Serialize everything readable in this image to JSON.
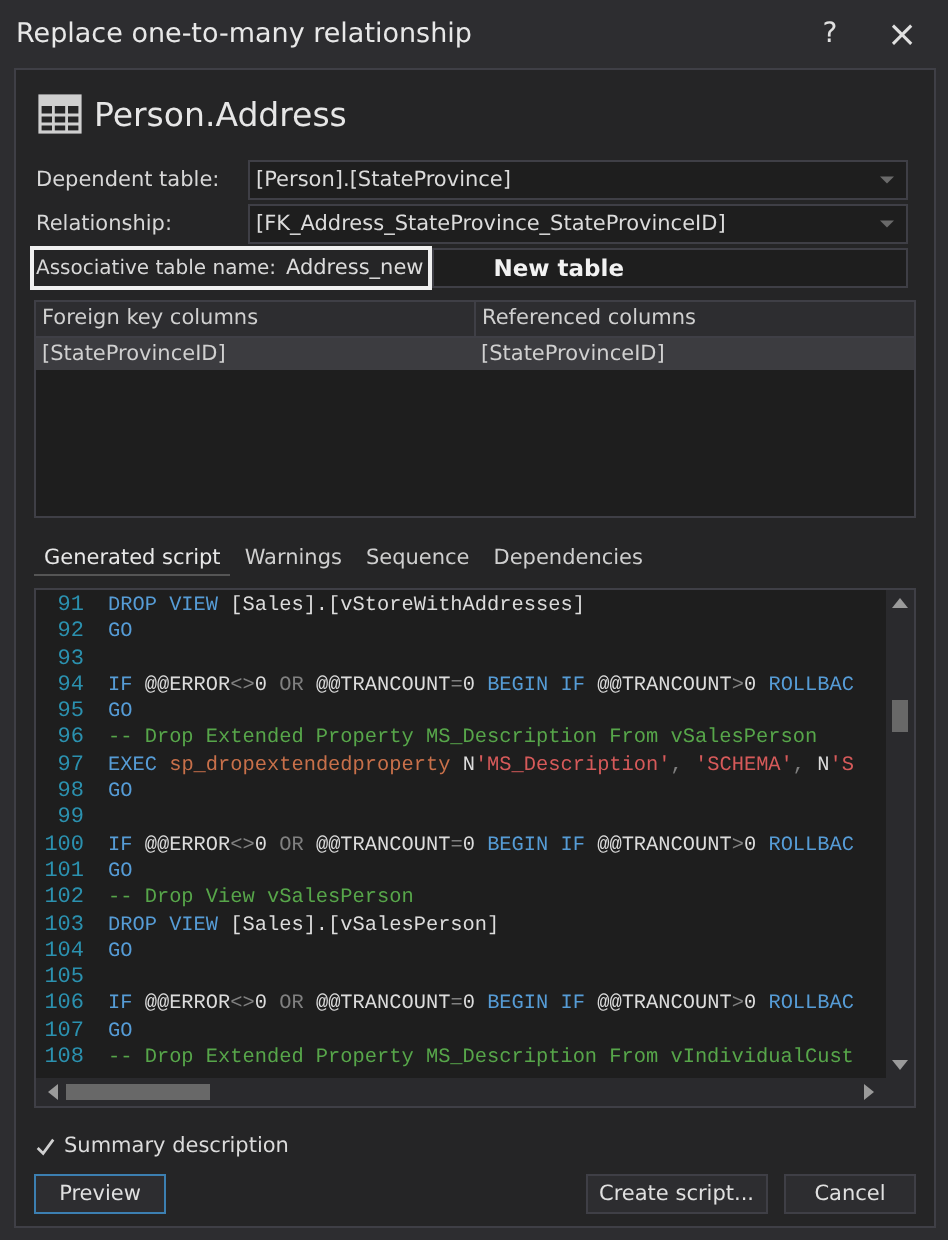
{
  "window": {
    "title": "Replace one-to-many relationship",
    "help": "?",
    "close": "×"
  },
  "header": {
    "title": "Person.Address"
  },
  "fields": [
    {
      "kind": "dropdown",
      "label": "Dependent table:",
      "value": "[Person].[StateProvince]",
      "highlighted": false
    },
    {
      "kind": "dropdown",
      "label": "Relationship:",
      "value": "[FK_Address_StateProvince_StateProvinceID]",
      "highlighted": false
    },
    {
      "kind": "text",
      "label": "Associative table name:",
      "value": "Address_new",
      "highlighted": true,
      "annotation": "New table"
    }
  ],
  "table": {
    "columns": [
      "Foreign key columns",
      "Referenced columns"
    ],
    "rows": [
      {
        "cells": [
          "[StateProvinceID]",
          "[StateProvinceID]"
        ],
        "selected": true
      }
    ]
  },
  "tabs": [
    {
      "label": "Generated script",
      "selected": true
    },
    {
      "label": "Warnings",
      "selected": false
    },
    {
      "label": "Sequence",
      "selected": false
    },
    {
      "label": "Dependencies",
      "selected": false
    }
  ],
  "code": [
    {
      "number": "91",
      "tokens": [
        {
          "kind": "kw",
          "text": "DROP VIEW "
        },
        {
          "kind": "plain",
          "text": "[Sales].[vStoreWithAddresses]"
        }
      ]
    },
    {
      "number": "92",
      "tokens": [
        {
          "kind": "kw",
          "text": "GO"
        }
      ]
    },
    {
      "number": "93"
    },
    {
      "number": "94",
      "tokens": [
        {
          "kind": "kw",
          "text": "IF "
        },
        {
          "kind": "plain",
          "text": "@@ERROR"
        },
        {
          "kind": "op",
          "text": "<>"
        },
        {
          "kind": "plain",
          "text": "0 "
        },
        {
          "kind": "op",
          "text": "OR "
        },
        {
          "kind": "plain",
          "text": "@@TRANCOUNT"
        },
        {
          "kind": "op",
          "text": "="
        },
        {
          "kind": "plain",
          "text": "0 "
        },
        {
          "kind": "kw",
          "text": "BEGIN IF "
        },
        {
          "kind": "plain",
          "text": "@@TRANCOUNT"
        },
        {
          "kind": "op",
          "text": ">"
        },
        {
          "kind": "plain",
          "text": "0 "
        },
        {
          "kind": "kw",
          "text": "ROLLBAC"
        }
      ]
    },
    {
      "number": "95",
      "tokens": [
        {
          "kind": "kw",
          "text": "GO"
        }
      ]
    },
    {
      "number": "96",
      "tokens": [
        {
          "kind": "comment",
          "text": "-- Drop Extended Property MS_Description From vSalesPerson"
        }
      ]
    },
    {
      "number": "97",
      "tokens": [
        {
          "kind": "kw",
          "text": "EXEC "
        },
        {
          "kind": "proc",
          "text": "sp_dropextendedproperty "
        },
        {
          "kind": "plain",
          "text": "N"
        },
        {
          "kind": "string",
          "text": "'MS_Description'"
        },
        {
          "kind": "op",
          "text": ", "
        },
        {
          "kind": "string",
          "text": "'SCHEMA'"
        },
        {
          "kind": "op",
          "text": ", "
        },
        {
          "kind": "plain",
          "text": "N"
        },
        {
          "kind": "string",
          "text": "'S"
        }
      ]
    },
    {
      "number": "98",
      "tokens": [
        {
          "kind": "kw",
          "text": "GO"
        }
      ]
    },
    {
      "number": "99"
    },
    {
      "number": "100",
      "tokens": [
        {
          "kind": "kw",
          "text": "IF "
        },
        {
          "kind": "plain",
          "text": "@@ERROR"
        },
        {
          "kind": "op",
          "text": "<>"
        },
        {
          "kind": "plain",
          "text": "0 "
        },
        {
          "kind": "op",
          "text": "OR "
        },
        {
          "kind": "plain",
          "text": "@@TRANCOUNT"
        },
        {
          "kind": "op",
          "text": "="
        },
        {
          "kind": "plain",
          "text": "0 "
        },
        {
          "kind": "kw",
          "text": "BEGIN IF "
        },
        {
          "kind": "plain",
          "text": "@@TRANCOUNT"
        },
        {
          "kind": "op",
          "text": ">"
        },
        {
          "kind": "plain",
          "text": "0 "
        },
        {
          "kind": "kw",
          "text": "ROLLBAC"
        }
      ]
    },
    {
      "number": "101",
      "tokens": [
        {
          "kind": "kw",
          "text": "GO"
        }
      ]
    },
    {
      "number": "102",
      "tokens": [
        {
          "kind": "comment",
          "text": "-- Drop View vSalesPerson"
        }
      ]
    },
    {
      "number": "103",
      "tokens": [
        {
          "kind": "kw",
          "text": "DROP VIEW "
        },
        {
          "kind": "plain",
          "text": "[Sales].[vSalesPerson]"
        }
      ]
    },
    {
      "number": "104",
      "tokens": [
        {
          "kind": "kw",
          "text": "GO"
        }
      ]
    },
    {
      "number": "105"
    },
    {
      "number": "106",
      "tokens": [
        {
          "kind": "kw",
          "text": "IF "
        },
        {
          "kind": "plain",
          "text": "@@ERROR"
        },
        {
          "kind": "op",
          "text": "<>"
        },
        {
          "kind": "plain",
          "text": "0 "
        },
        {
          "kind": "op",
          "text": "OR "
        },
        {
          "kind": "plain",
          "text": "@@TRANCOUNT"
        },
        {
          "kind": "op",
          "text": "="
        },
        {
          "kind": "plain",
          "text": "0 "
        },
        {
          "kind": "kw",
          "text": "BEGIN IF "
        },
        {
          "kind": "plain",
          "text": "@@TRANCOUNT"
        },
        {
          "kind": "op",
          "text": ">"
        },
        {
          "kind": "plain",
          "text": "0 "
        },
        {
          "kind": "kw",
          "text": "ROLLBAC"
        }
      ]
    },
    {
      "number": "107",
      "tokens": [
        {
          "kind": "kw",
          "text": "GO"
        }
      ]
    },
    {
      "number": "108",
      "tokens": [
        {
          "kind": "comment",
          "text": "-- Drop Extended Property MS_Description From vIndividualCust"
        }
      ]
    }
  ],
  "summary": {
    "label": "Summary description",
    "checked": true
  },
  "buttons": [
    {
      "label": "Preview",
      "focused": true
    },
    {
      "label": "Create script...",
      "focused": false
    },
    {
      "label": "Cancel",
      "focused": false
    }
  ]
}
